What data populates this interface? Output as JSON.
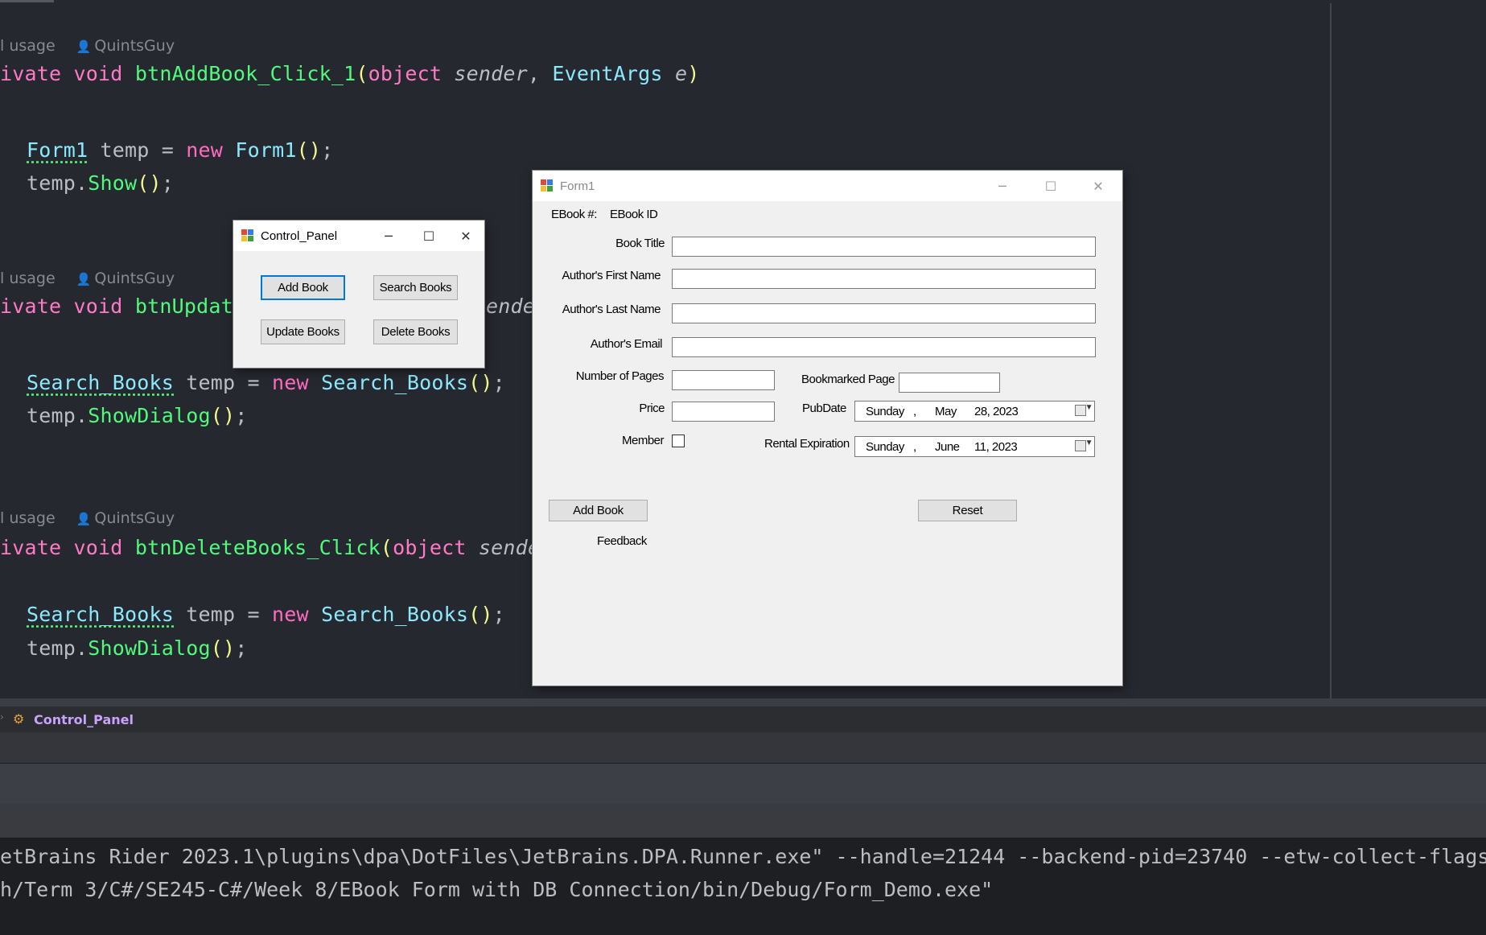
{
  "editor": {
    "hints": [
      {
        "usage": "l usage",
        "author": "QuintsGuy"
      },
      {
        "usage": "l usage",
        "author": "QuintsGuy"
      },
      {
        "usage": "l usage",
        "author": "QuintsGuy"
      }
    ],
    "method1": {
      "mod": "ivate",
      "void": "void",
      "name": "btnAddBook_Click_1",
      "open": "(",
      "t1": "object",
      "p1": "sender",
      "t2": "EventArgs",
      "p2": "e",
      "close": ")"
    },
    "method1_body": [
      {
        "type": "Form1",
        "var": " temp = ",
        "new": "new",
        "ctor": "Form1",
        "parens": "()",
        "end": ";"
      },
      {
        "obj": "temp.",
        "call": "Show",
        "parens": "()",
        "end": ";"
      }
    ],
    "method2": {
      "mod": "ivate",
      "void": "void",
      "name": "btnUpdat",
      "tail": "ende"
    },
    "method2_body": [
      {
        "type": "Search_Books",
        "var": " temp = ",
        "new": "new",
        "ctor": "Search_Books",
        "parens": "()",
        "end": ";"
      },
      {
        "obj": "temp.",
        "call": "ShowDialog",
        "parens": "()",
        "end": ";"
      }
    ],
    "method3": {
      "mod": "ivate",
      "void": "void",
      "name": "btnDeleteBooks_Click",
      "open": "(",
      "t1": "object",
      "tail": "sende"
    },
    "method3_body": [
      {
        "type": "Search_Books",
        "var": " temp = ",
        "new": "new",
        "ctor": "Search_Books",
        "parens": "()",
        "end": ";"
      },
      {
        "obj": "temp.",
        "call": "ShowDialog",
        "parens": "()",
        "end": ";"
      }
    ]
  },
  "breadcrumb": {
    "label": "Control_Panel"
  },
  "console": {
    "line1": "etBrains Rider 2023.1\\plugins\\dpa\\DotFiles\\JetBrains.DPA.Runner.exe\" --handle=21244 --backend-pid=23740 --etw-collect-flags",
    "line2": "h/Term 3/C#/SE245-C#/Week 8/EBook Form with DB Connection/bin/Debug/Form_Demo.exe\""
  },
  "control_panel": {
    "title": "Control_Panel",
    "buttons": {
      "add": "Add Book",
      "search": "Search Books",
      "update": "Update Books",
      "delete": "Delete Books"
    }
  },
  "form1": {
    "title": "Form1",
    "ebook_label": "EBook #:",
    "ebook_id": "EBook ID",
    "labels": {
      "book_title": "Book Title",
      "first_name": "Author's First Name",
      "last_name": "Author's Last Name",
      "email": "Author's Email",
      "pages": "Number of Pages",
      "bookmarked": "Bookmarked Page",
      "price": "Price",
      "pubdate": "PubDate",
      "member": "Member",
      "rental": "Rental Expiration"
    },
    "pubdate": {
      "day": "Sunday",
      "sep": ",",
      "month": "May",
      "date": "28, 2023"
    },
    "rental": {
      "day": "Sunday",
      "sep": ",",
      "month": "June",
      "date": "11, 2023"
    },
    "buttons": {
      "add": "Add Book",
      "reset": "Reset"
    },
    "feedback": "Feedback"
  },
  "colors": {
    "editor_bg": "#262830",
    "keyword": "#ff79c6",
    "function": "#50fa7b",
    "type": "#8be9fd",
    "paren": "#f1fa8c",
    "accent": "#0078d7"
  }
}
